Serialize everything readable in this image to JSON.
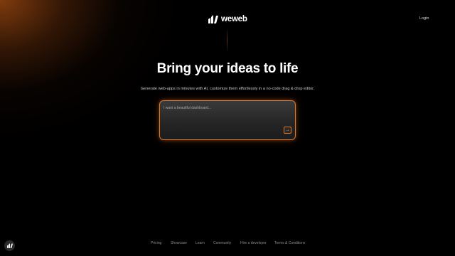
{
  "header": {
    "brand": "weweb",
    "login_label": "Login",
    "logo_icon": "weweb-logo-icon"
  },
  "hero": {
    "title": "Bring your ideas to life",
    "subtitle": "Generate web-apps in minutes with AI, customize them effortlessly in a no-code drag & drop editor."
  },
  "prompt": {
    "placeholder": "I want a beautiful dashboard...",
    "value": "",
    "send_icon": "arrow-right-icon",
    "send_glyph": "→"
  },
  "footer": {
    "links": [
      "Pricing",
      "Showcase",
      "Learn",
      "Community",
      "Hire a developer",
      "Terms & Conditions"
    ]
  },
  "corner_badge": {
    "icon": "weweb-logo-icon"
  },
  "colors": {
    "background": "#000000",
    "accent": "#d97a2a",
    "glow": "#96460f"
  }
}
